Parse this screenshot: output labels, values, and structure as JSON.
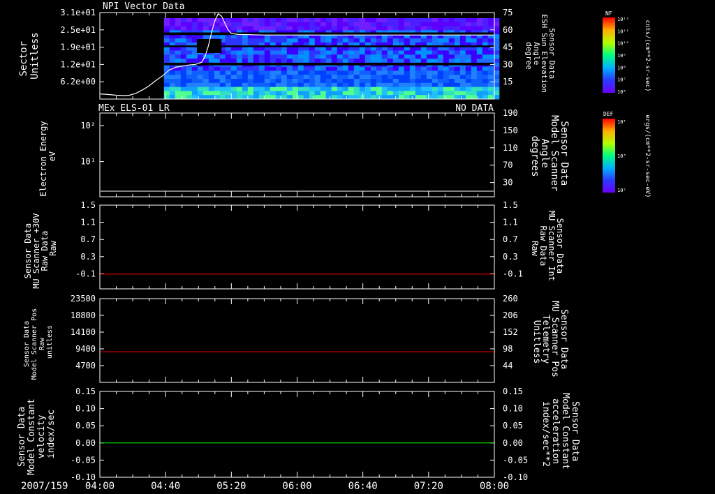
{
  "chart_data": {
    "date": "2007/159",
    "x_ticks": [
      "04:00",
      "04:40",
      "05:20",
      "06:00",
      "06:40",
      "07:20",
      "08:00"
    ],
    "x_range_minutes": [
      240,
      480
    ],
    "panels": [
      {
        "type": "heatmap",
        "title": "NPI Vector Data",
        "status": "",
        "ylabel_lines": [
          "Sector",
          "Unitless"
        ],
        "yticks_left": [
          "3.1e+01",
          "2.5e+01",
          "1.9e+01",
          "1.2e+01",
          "6.2e+00"
        ],
        "ylabel_right_lines": [
          "Sensor Data",
          "ESH Sun Elevation",
          "Angle",
          "degree"
        ],
        "yticks_right": [
          "75",
          "60",
          "45",
          "30",
          "15"
        ],
        "ylim_right": [
          0,
          75
        ],
        "overlay_color": "#ffffff",
        "overlay_series": [
          {
            "t": 240,
            "v": 4.5
          },
          {
            "t": 245,
            "v": 4.0
          },
          {
            "t": 250,
            "v": 3.3
          },
          {
            "t": 255,
            "v": 3.0
          },
          {
            "t": 258,
            "v": 3.3
          },
          {
            "t": 262,
            "v": 5.0
          },
          {
            "t": 266,
            "v": 8.0
          },
          {
            "t": 270,
            "v": 11.5
          },
          {
            "t": 274,
            "v": 16.0
          },
          {
            "t": 278,
            "v": 20.0
          },
          {
            "t": 282,
            "v": 25.0
          },
          {
            "t": 286,
            "v": 27.5
          },
          {
            "t": 290,
            "v": 28.5
          },
          {
            "t": 294,
            "v": 29.5
          },
          {
            "t": 298,
            "v": 30.0
          },
          {
            "t": 302,
            "v": 32.0
          },
          {
            "t": 304,
            "v": 37.0
          },
          {
            "t": 306,
            "v": 46.0
          },
          {
            "t": 308,
            "v": 58.0
          },
          {
            "t": 310,
            "v": 68.0
          },
          {
            "t": 312,
            "v": 74.0
          },
          {
            "t": 314,
            "v": 72.0
          },
          {
            "t": 316,
            "v": 66.0
          },
          {
            "t": 318,
            "v": 60.0
          },
          {
            "t": 320,
            "v": 57.0
          },
          {
            "t": 324,
            "v": 56.0
          },
          {
            "t": 340,
            "v": 55.5
          },
          {
            "t": 480,
            "v": 55.5
          }
        ],
        "colorbar": {
          "label": "NF",
          "units": "cnts/(cm**2-sr-sec)",
          "ticks": [
            "10¹²",
            "10¹¹",
            "10¹⁰",
            "10⁹",
            "10⁸",
            "10⁷",
            "10⁶"
          ]
        }
      },
      {
        "type": "line",
        "title": "MEx ELS-01 LR",
        "status": "NO DATA",
        "ylabel_lines": [
          "Electron Energy",
          "eV"
        ],
        "yticks_left": [
          "10²",
          "10¹"
        ],
        "ylabel_right_lines": [
          "Sensor Data",
          "Model Scanner",
          "Angle",
          "degrees"
        ],
        "yticks_right": [
          "190",
          "150",
          "110",
          "70",
          "30"
        ],
        "ylim_right": [
          0,
          190
        ],
        "line_color": "#ffffff",
        "line_value": 11,
        "colorbar": {
          "label": "DEF",
          "units": "ergs/(cm**2-sr-sec-eV)",
          "ticks": [
            "10⁴",
            "10³",
            "10²"
          ]
        }
      },
      {
        "type": "line",
        "title": "",
        "status": "",
        "ylabel_lines": [
          "Sensor Data",
          "MU Scanner +30V",
          "Raw Data",
          "Raw"
        ],
        "yticks_left": [
          "1.5",
          "1.1",
          "0.7",
          "0.3",
          "-0.1"
        ],
        "ylim": [
          -0.32,
          1.5
        ],
        "ylabel_right_lines": [
          "Sensor Data",
          "MU Scanner Int",
          "Raw Data",
          "Raw"
        ],
        "yticks_right": [
          "1.5",
          "1.1",
          "0.7",
          "0.3",
          "-0.1"
        ],
        "right_color": "#ff0000",
        "line_color": "#ff0000",
        "line_value": 0.0
      },
      {
        "type": "line",
        "title": "",
        "status": "",
        "ylabel_lines": [
          "Sensor Data",
          "Model Scanner Pos",
          "Raw",
          "unitless"
        ],
        "yticks_left": [
          "23500",
          "18800",
          "14100",
          "9400",
          "4700"
        ],
        "ylim": [
          0,
          23500
        ],
        "ylabel_right_lines": [
          "Sensor Data",
          "MU Scanner Pos",
          "Telemetry",
          "Unitless"
        ],
        "yticks_right": [
          "260",
          "206",
          "152",
          "98",
          "44"
        ],
        "right_color": "#ff0000",
        "line_color": "#ff0000",
        "line_value": 8600
      },
      {
        "type": "line",
        "title": "",
        "status": "",
        "ylabel_lines": [
          "Sensor Data",
          "Model Constant",
          "velocity",
          "index/sec"
        ],
        "yticks_left": [
          "0.15",
          "0.10",
          "0.05",
          "0.00",
          "-0.05",
          "-0.10"
        ],
        "ylim": [
          -0.1,
          0.15
        ],
        "ylabel_right_lines": [
          "Sensor Data",
          "Model Constant",
          "acceleration",
          "index/sec**2"
        ],
        "yticks_right": [
          "0.15",
          "0.10",
          "0.05",
          "0.00",
          "-0.05",
          "-0.10"
        ],
        "right_color": "#00ff00",
        "line_color": "#00ff00",
        "line_value": 0.0
      }
    ]
  }
}
